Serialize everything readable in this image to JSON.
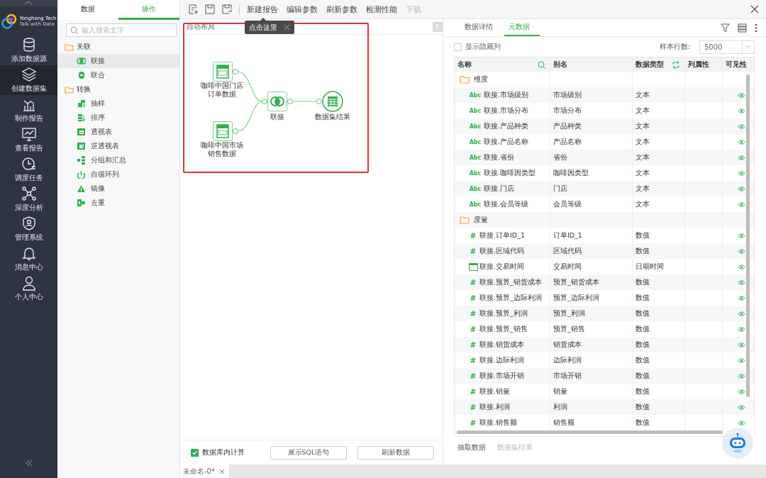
{
  "nav": {
    "logo": {
      "name": "Yonghong Tech",
      "tagline": "Talk with Data"
    },
    "items": [
      {
        "label": "添加数据源",
        "selected": false
      },
      {
        "label": "创建数据集",
        "selected": true
      },
      {
        "label": "制作报告",
        "selected": false
      },
      {
        "label": "查看报告",
        "selected": false
      },
      {
        "label": "调度任务",
        "selected": false
      },
      {
        "label": "深度分析",
        "selected": false
      },
      {
        "label": "管理系统",
        "selected": false
      },
      {
        "label": "消息中心",
        "selected": false
      },
      {
        "label": "个人中心",
        "selected": false
      }
    ]
  },
  "side_panel": {
    "tabs": [
      {
        "label": "数据",
        "selected": false
      },
      {
        "label": "操作",
        "selected": true
      }
    ],
    "search": {
      "placeholder": "输入搜索文字"
    },
    "tree": [
      {
        "label": "关联",
        "children": [
          {
            "label": "联接",
            "selected": true
          },
          {
            "label": "联合",
            "selected": false
          }
        ]
      },
      {
        "label": "转换",
        "children": [
          {
            "label": "抽样",
            "selected": false
          },
          {
            "label": "排序",
            "selected": false
          },
          {
            "label": "透视表",
            "selected": false
          },
          {
            "label": "逆透视表",
            "selected": false
          },
          {
            "label": "分组和汇总",
            "selected": false
          },
          {
            "label": "自循环列",
            "selected": false
          },
          {
            "label": "镜像",
            "selected": false
          },
          {
            "label": "去重",
            "selected": false
          }
        ]
      }
    ]
  },
  "toolbar": {
    "actions": [
      {
        "label": "新建报告",
        "disabled": false
      },
      {
        "label": "编辑参数",
        "disabled": false
      },
      {
        "label": "刷新参数",
        "disabled": false
      },
      {
        "label": "检测性能",
        "disabled": false
      },
      {
        "label": "下载",
        "disabled": true
      }
    ]
  },
  "canvas": {
    "header": "自动布局",
    "tooltip": "点击这里",
    "nodes": [
      {
        "kind": "sql",
        "label": "咖啡中国门店订单数据"
      },
      {
        "kind": "sql",
        "label": "咖啡中国市场销售数据"
      },
      {
        "kind": "join",
        "label": "联接"
      },
      {
        "kind": "result",
        "label": "数据集结果"
      }
    ],
    "db_compute": {
      "label": "数据库内计算",
      "checked": true
    },
    "buttons": [
      "展示SQL语句",
      "刷新数据"
    ]
  },
  "doc_tabs": [
    {
      "label": "未命名-0*",
      "selected": true
    }
  ],
  "metadata_panel": {
    "tabs": [
      {
        "label": "数据详情",
        "selected": false
      },
      {
        "label": "元数据",
        "selected": true
      }
    ],
    "show_hidden": {
      "label": "显示隐藏列",
      "checked": false
    },
    "sample_rows": {
      "label": "样本行数:",
      "value": "5000"
    },
    "columns": [
      "名称",
      "别名",
      "数据类型",
      "列属性",
      "可见性"
    ],
    "groups": [
      {
        "label": "维度",
        "children": [
          {
            "kind": "text",
            "icon": "Abc",
            "name": "联接.市场级别",
            "alias": "市场级别",
            "type": "文本",
            "visible": true
          },
          {
            "kind": "text",
            "icon": "Abc",
            "name": "联接.市场分布",
            "alias": "市场分布",
            "type": "文本",
            "visible": true
          },
          {
            "kind": "text",
            "icon": "Abc",
            "name": "联接.产品种类",
            "alias": "产品种类",
            "type": "文本",
            "visible": true
          },
          {
            "kind": "text",
            "icon": "Abc",
            "name": "联接.产品名称",
            "alias": "产品名称",
            "type": "文本",
            "visible": true
          },
          {
            "kind": "text",
            "icon": "Abc",
            "name": "联接.省份",
            "alias": "省份",
            "type": "文本",
            "visible": true
          },
          {
            "kind": "text",
            "icon": "Abc",
            "name": "联接.咖啡因类型",
            "alias": "咖啡因类型",
            "type": "文本",
            "visible": true
          },
          {
            "kind": "text",
            "icon": "Abc",
            "name": "联接.门店",
            "alias": "门店",
            "type": "文本",
            "visible": true
          },
          {
            "kind": "text",
            "icon": "Abc",
            "name": "联接.会员等级",
            "alias": "会员等级",
            "type": "文本",
            "visible": true
          }
        ]
      },
      {
        "label": "度量",
        "children": [
          {
            "kind": "number",
            "icon": "#",
            "name": "联接.订单ID_1",
            "alias": "订单ID_1",
            "type": "数值",
            "visible": true
          },
          {
            "kind": "number",
            "icon": "#",
            "name": "联接.区域代码",
            "alias": "区域代码",
            "type": "数值",
            "visible": true
          },
          {
            "kind": "datetime",
            "name": "联接.交易时间",
            "alias": "交易时间",
            "type": "日期时间",
            "visible": true
          },
          {
            "kind": "number",
            "icon": "#",
            "name": "联接.预算_销货成本",
            "alias": "预算_销货成本",
            "type": "数值",
            "visible": true
          },
          {
            "kind": "number",
            "icon": "#",
            "name": "联接.预算_边际利润",
            "alias": "预算_边际利润",
            "type": "数值",
            "visible": true
          },
          {
            "kind": "number",
            "icon": "#",
            "name": "联接.预算_利润",
            "alias": "预算_利润",
            "type": "数值",
            "visible": true
          },
          {
            "kind": "number",
            "icon": "#",
            "name": "联接.预算_销售",
            "alias": "预算_销售",
            "type": "数值",
            "visible": true
          },
          {
            "kind": "number",
            "icon": "#",
            "name": "联接.销货成本",
            "alias": "销货成本",
            "type": "数值",
            "visible": true
          },
          {
            "kind": "number",
            "icon": "#",
            "name": "联接.边际利润",
            "alias": "边际利润",
            "type": "数值",
            "visible": true
          },
          {
            "kind": "number",
            "icon": "#",
            "name": "联接.市场开销",
            "alias": "市场开销",
            "type": "数值",
            "visible": true
          },
          {
            "kind": "number",
            "icon": "#",
            "name": "联接.销量",
            "alias": "销量",
            "type": "数值",
            "visible": true
          },
          {
            "kind": "number",
            "icon": "#",
            "name": "联接.利润",
            "alias": "利润",
            "type": "数值",
            "visible": true
          },
          {
            "kind": "number",
            "icon": "#",
            "name": "联接.销售额",
            "alias": "销售额",
            "type": "数值",
            "visible": true
          }
        ]
      }
    ],
    "bottom_tabs": [
      {
        "label": "抽取数据",
        "selected": true
      },
      {
        "label": "数据集结果",
        "selected": false
      }
    ]
  }
}
